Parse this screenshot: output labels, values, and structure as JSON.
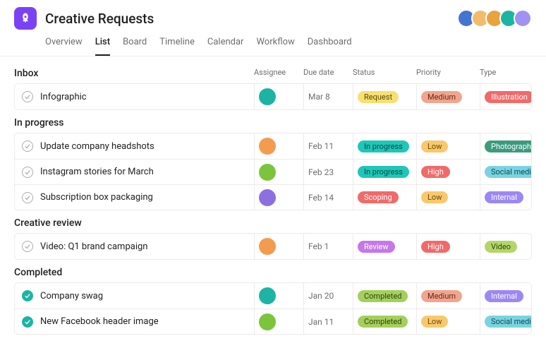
{
  "project": {
    "title": "Creative Requests",
    "icon": "rocket"
  },
  "tabs": [
    {
      "label": "Overview",
      "active": false
    },
    {
      "label": "List",
      "active": true
    },
    {
      "label": "Board",
      "active": false
    },
    {
      "label": "Timeline",
      "active": false
    },
    {
      "label": "Calendar",
      "active": false
    },
    {
      "label": "Workflow",
      "active": false
    },
    {
      "label": "Dashboard",
      "active": false
    }
  ],
  "header_avatars": [
    {
      "bg": "#4573d2"
    },
    {
      "bg": "#f1bd6c"
    },
    {
      "bg": "#e8a33d"
    },
    {
      "bg": "#1db4a4"
    },
    {
      "bg": "#a191f3"
    }
  ],
  "columns": [
    "Assignee",
    "Due date",
    "Status",
    "Priority",
    "Type"
  ],
  "sections": [
    {
      "title": "Inbox",
      "tasks": [
        {
          "name": "Infographic",
          "done": false,
          "assignee_bg": "#1db4a4",
          "due": "Mar 8",
          "status": {
            "label": "Request",
            "bg": "#f8df72",
            "fg": "#594c00"
          },
          "priority": {
            "label": "Medium",
            "bg": "#f1a58f",
            "fg": "#6b2515"
          },
          "type": {
            "label": "Illustration",
            "bg": "#f06a6a",
            "fg": "#fff"
          }
        }
      ]
    },
    {
      "title": "In progress",
      "tasks": [
        {
          "name": "Update company headshots",
          "done": false,
          "assignee_bg": "#f39c4f",
          "due": "Feb 11",
          "status": {
            "label": "In progress",
            "bg": "#1ec7b8",
            "fg": "#064c44"
          },
          "priority": {
            "label": "Low",
            "bg": "#f9c86c",
            "fg": "#6a4b00"
          },
          "type": {
            "label": "Photography",
            "bg": "#3c9a7d",
            "fg": "#fff"
          }
        },
        {
          "name": "Instagram stories for March",
          "done": false,
          "assignee_bg": "#7bc43c",
          "due": "Feb 23",
          "status": {
            "label": "In progress",
            "bg": "#1ec7b8",
            "fg": "#064c44"
          },
          "priority": {
            "label": "High",
            "bg": "#f06a6a",
            "fg": "#fff"
          },
          "type": {
            "label": "Social media",
            "bg": "#7ad3e0",
            "fg": "#0a4a55"
          }
        },
        {
          "name": "Subscription box packaging",
          "done": false,
          "assignee_bg": "#8e6fe0",
          "due": "Feb 14",
          "status": {
            "label": "Scoping",
            "bg": "#f06a6a",
            "fg": "#fff"
          },
          "priority": {
            "label": "Low",
            "bg": "#f9c86c",
            "fg": "#6a4b00"
          },
          "type": {
            "label": "Internal",
            "bg": "#9d87f2",
            "fg": "#fff"
          }
        }
      ]
    },
    {
      "title": "Creative review",
      "tasks": [
        {
          "name": "Video: Q1 brand campaign",
          "done": false,
          "assignee_bg": "#f39c4f",
          "due": "Feb 1",
          "status": {
            "label": "Review",
            "bg": "#c577e8",
            "fg": "#fff"
          },
          "priority": {
            "label": "High",
            "bg": "#f06a6a",
            "fg": "#fff"
          },
          "type": {
            "label": "Video",
            "bg": "#b3d66b",
            "fg": "#2f4700"
          }
        }
      ]
    },
    {
      "title": "Completed",
      "tasks": [
        {
          "name": "Company swag",
          "done": true,
          "assignee_bg": "#1db4a4",
          "due": "Jan 20",
          "status": {
            "label": "Completed",
            "bg": "#a4cf5e",
            "fg": "#2f4700"
          },
          "priority": {
            "label": "Medium",
            "bg": "#f1a58f",
            "fg": "#6b2515"
          },
          "type": {
            "label": "Internal",
            "bg": "#9d87f2",
            "fg": "#fff"
          }
        },
        {
          "name": "New Facebook header image",
          "done": true,
          "assignee_bg": "#7bc43c",
          "due": "Jan 11",
          "status": {
            "label": "Completed",
            "bg": "#a4cf5e",
            "fg": "#2f4700"
          },
          "priority": {
            "label": "Low",
            "bg": "#f9c86c",
            "fg": "#6a4b00"
          },
          "type": {
            "label": "Social media",
            "bg": "#7ad3e0",
            "fg": "#0a4a55"
          }
        }
      ]
    }
  ]
}
